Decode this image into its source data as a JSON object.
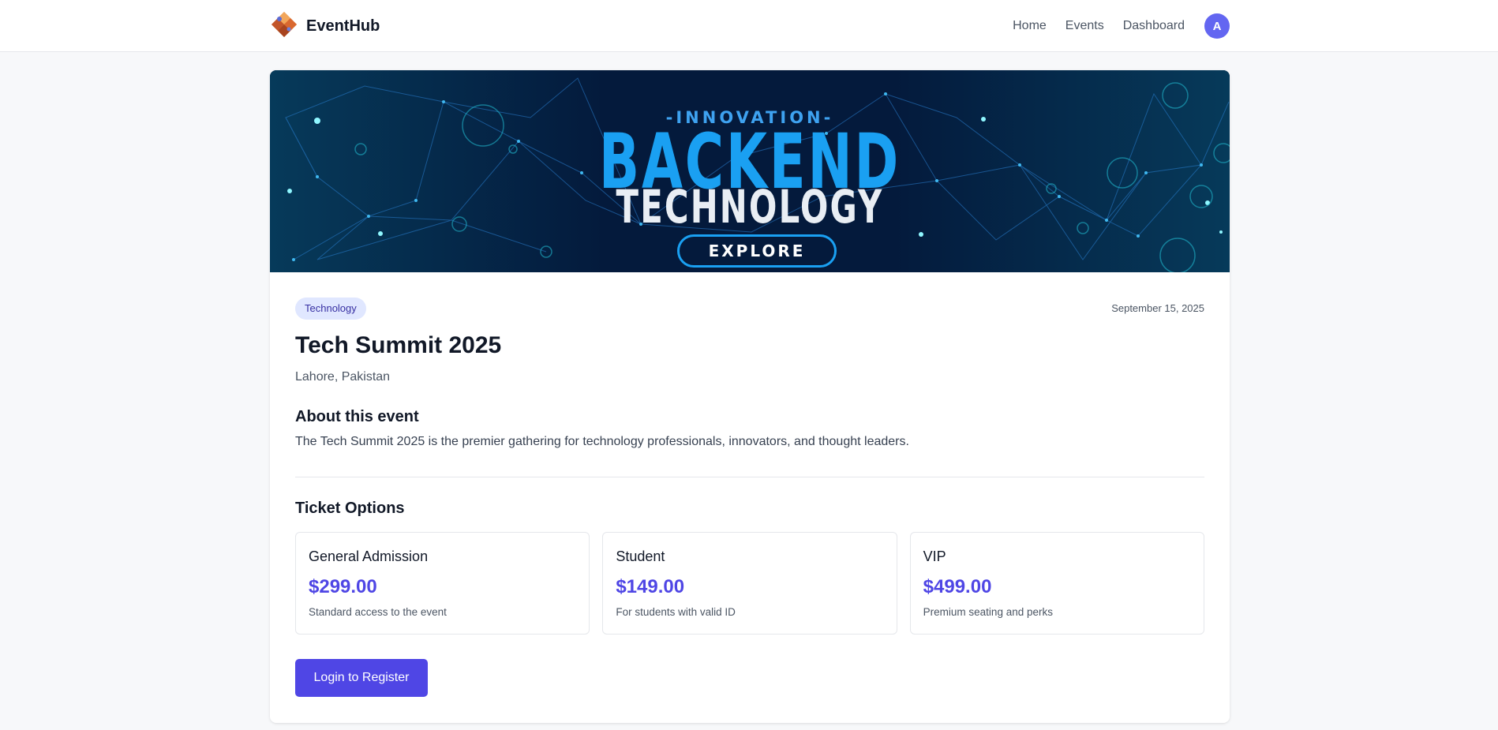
{
  "nav": {
    "brand": "EventHub",
    "links": [
      "Home",
      "Events",
      "Dashboard"
    ],
    "avatar_initial": "A"
  },
  "banner": {
    "line1": "-INNOVATION-",
    "line2": "BACKEND",
    "line3": "TECHNOLOGY",
    "button": "EXPLORE"
  },
  "event": {
    "category": "Technology",
    "date": "September 15, 2025",
    "title": "Tech Summit 2025",
    "location": "Lahore, Pakistan",
    "about_heading": "About this event",
    "description": "The Tech Summit 2025 is the premier gathering for technology professionals, innovators, and thought leaders."
  },
  "tickets": {
    "heading": "Ticket Options",
    "options": [
      {
        "name": "General Admission",
        "price": "$299.00",
        "description": "Standard access to the event"
      },
      {
        "name": "Student",
        "price": "$149.00",
        "description": "For students with valid ID"
      },
      {
        "name": "VIP",
        "price": "$499.00",
        "description": "Premium seating and perks"
      }
    ]
  },
  "register_button": "Login to Register",
  "colors": {
    "accent": "#4f46e5",
    "avatar": "#6366f1",
    "badge_bg": "#e0e7ff",
    "banner_bg": "#051634"
  }
}
